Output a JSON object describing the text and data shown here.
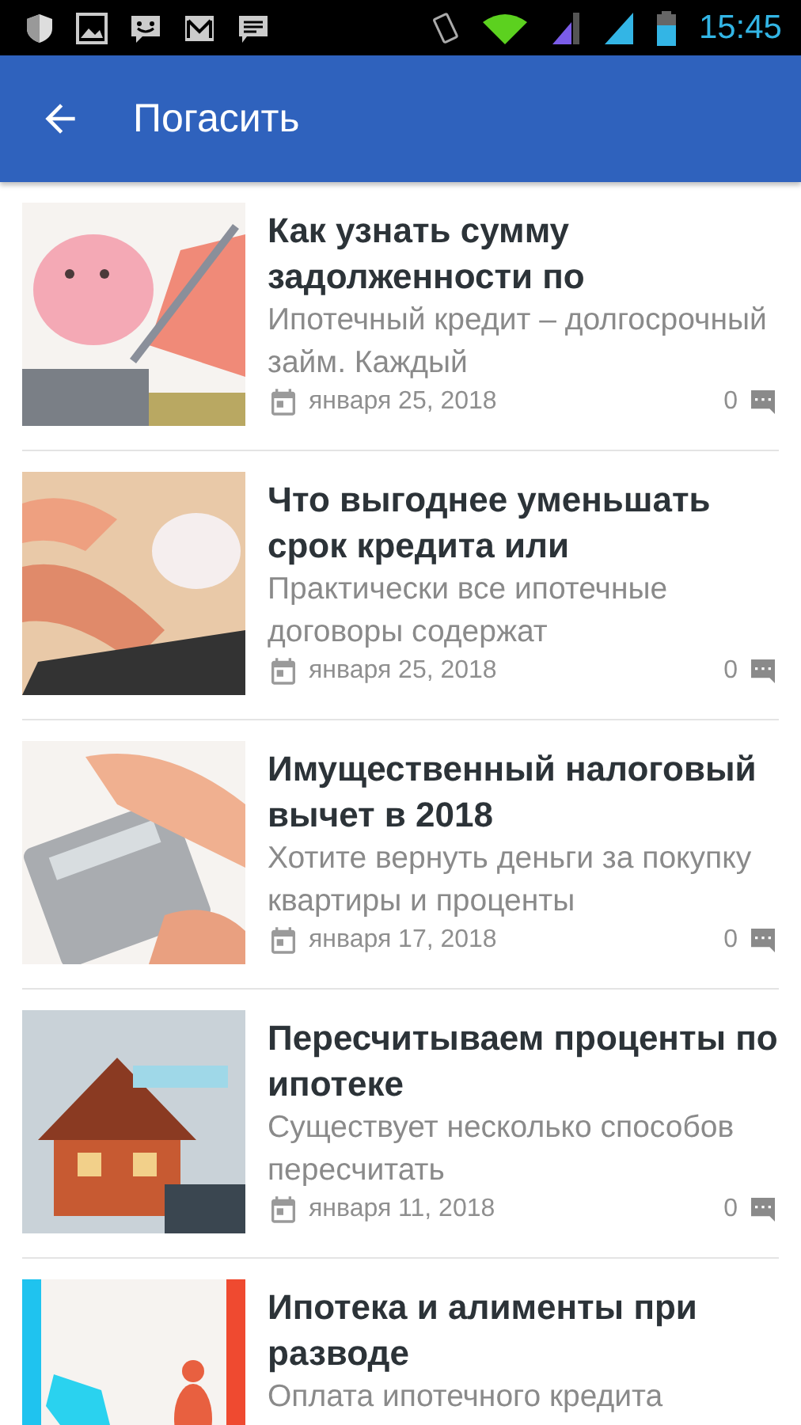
{
  "status_bar": {
    "time": "15:45"
  },
  "app_bar": {
    "title": "Погасить"
  },
  "articles": [
    {
      "title": "Как узнать сумму задолженности по",
      "excerpt": "Ипотечный кредит – долгосрочный займ. Каждый",
      "date": "января 25, 2018",
      "comments": "0"
    },
    {
      "title": "Что выгоднее уменьшать срок кредита или",
      "excerpt": "Практически все ипотечные договоры содержат",
      "date": "января 25, 2018",
      "comments": "0"
    },
    {
      "title": "Имущественный налоговый вычет в 2018",
      "excerpt": "Хотите вернуть деньги за покупку квартиры и проценты",
      "date": "января 17, 2018",
      "comments": "0"
    },
    {
      "title": "Пересчитываем проценты по ипотеке",
      "excerpt": "Существует несколько способов пересчитать",
      "date": "января 11, 2018",
      "comments": "0"
    },
    {
      "title": "Ипотека и алименты при разводе",
      "excerpt": "Оплата ипотечного кредита"
    }
  ]
}
